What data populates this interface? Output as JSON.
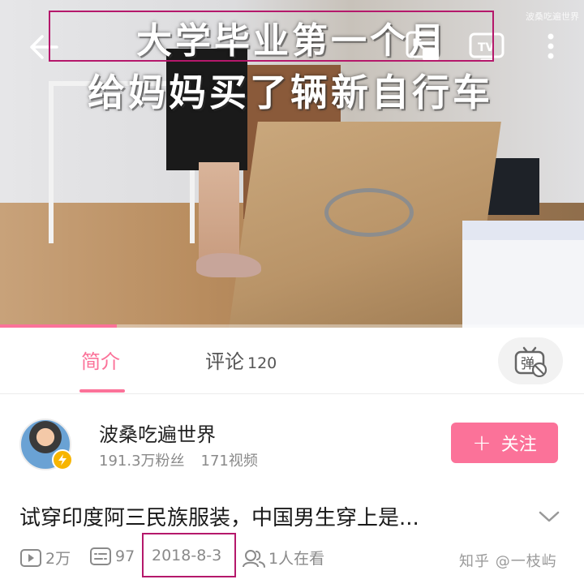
{
  "video": {
    "caption_line1": "大学毕业第一个月",
    "caption_line2": "给妈妈买了辆新自行车",
    "watermark": "波桑吃遍世界",
    "progress_percent": 20,
    "icons": {
      "back": "arrow-left-icon",
      "pip": "picture-in-picture-icon",
      "cast": "tv-cast-icon",
      "more": "more-vertical-icon"
    }
  },
  "tabs": {
    "intro_label": "简介",
    "comment_label": "评论",
    "comment_count": "120",
    "danmaku_label": "弹"
  },
  "uploader": {
    "name": "波桑吃遍世界",
    "fans": "191.3万粉丝",
    "videos": "171视频",
    "follow_label": "关注"
  },
  "detail": {
    "title": "试穿印度阿三民族服装，中国男生穿上是...",
    "plays": "2万",
    "danmaku_count": "97",
    "date": "2018-8-3",
    "watching": "1人在看"
  },
  "watermark": "知乎 @一枝屿",
  "colors": {
    "accent": "#fb7299",
    "highlight_box": "#b5186b",
    "badge": "#f7b500"
  }
}
